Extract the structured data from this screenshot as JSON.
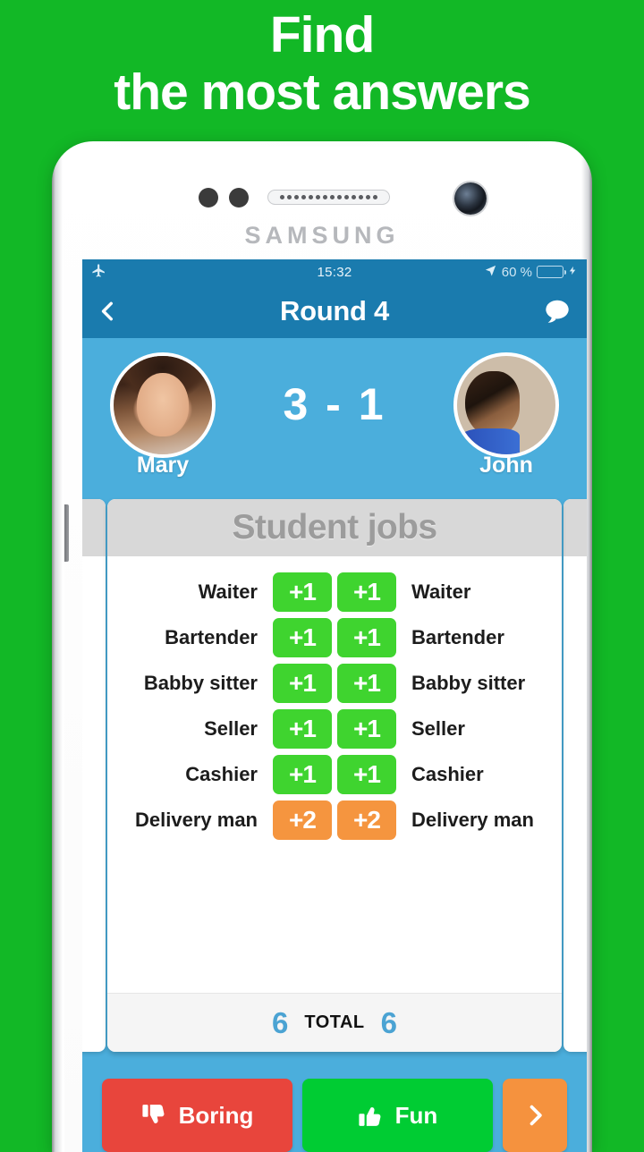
{
  "promo": {
    "line1": "Find",
    "line2": "the most answers",
    "background_color": "#12b826",
    "text_color": "#ffffff"
  },
  "device": {
    "brand": "SAMSUNG",
    "body_color": "#ffffff"
  },
  "status_bar": {
    "airplane_icon": "airplane-icon",
    "time": "15:32",
    "location_icon": "location-arrow-icon",
    "battery_percent": "60 %",
    "battery_level": 60,
    "charging_icon": "lightning-bolt-icon",
    "background_color": "#1a7bae"
  },
  "navbar": {
    "back_icon": "chevron-left-icon",
    "title": "Round 4",
    "chat_icon": "speech-bubble-icon",
    "background_color": "#1a7bae"
  },
  "score": {
    "left_player": {
      "name": "Mary",
      "avatar": "avatar-mary"
    },
    "right_player": {
      "name": "John",
      "avatar": "avatar-john"
    },
    "scoreline": "3 - 1",
    "left_score": 3,
    "right_score": 1,
    "background_color": "#4baedc"
  },
  "card": {
    "title": "Student jobs",
    "title_color": "#9c9c9c",
    "header_color": "#d8d8d8",
    "rows": [
      {
        "left_answer": "Waiter",
        "left_points": "+1",
        "left_color": "#3fd42f",
        "right_points": "+1",
        "right_color": "#3fd42f",
        "right_answer": "Waiter"
      },
      {
        "left_answer": "Bartender",
        "left_points": "+1",
        "left_color": "#3fd42f",
        "right_points": "+1",
        "right_color": "#3fd42f",
        "right_answer": "Bartender"
      },
      {
        "left_answer": "Babby sitter",
        "left_points": "+1",
        "left_color": "#3fd42f",
        "right_points": "+1",
        "right_color": "#3fd42f",
        "right_answer": "Babby sitter"
      },
      {
        "left_answer": "Seller",
        "left_points": "+1",
        "left_color": "#3fd42f",
        "right_points": "+1",
        "right_color": "#3fd42f",
        "right_answer": "Seller"
      },
      {
        "left_answer": "Cashier",
        "left_points": "+1",
        "left_color": "#3fd42f",
        "right_points": "+1",
        "right_color": "#3fd42f",
        "right_answer": "Cashier"
      },
      {
        "left_answer": "Delivery man",
        "left_points": "+2",
        "left_color": "#f5953f",
        "right_points": "+2",
        "right_color": "#f5953f",
        "right_answer": "Delivery man"
      }
    ],
    "total": {
      "left_total": "6",
      "label": "TOTAL",
      "right_total": "6",
      "number_color": "#4ba3d3"
    }
  },
  "actions": {
    "boring": {
      "label": "Boring",
      "icon": "thumbs-down-icon",
      "color": "#e8453c"
    },
    "fun": {
      "label": "Fun",
      "icon": "thumbs-up-icon",
      "color": "#00cc33"
    },
    "next": {
      "icon": "chevron-right-icon",
      "color": "#f5923e"
    }
  }
}
